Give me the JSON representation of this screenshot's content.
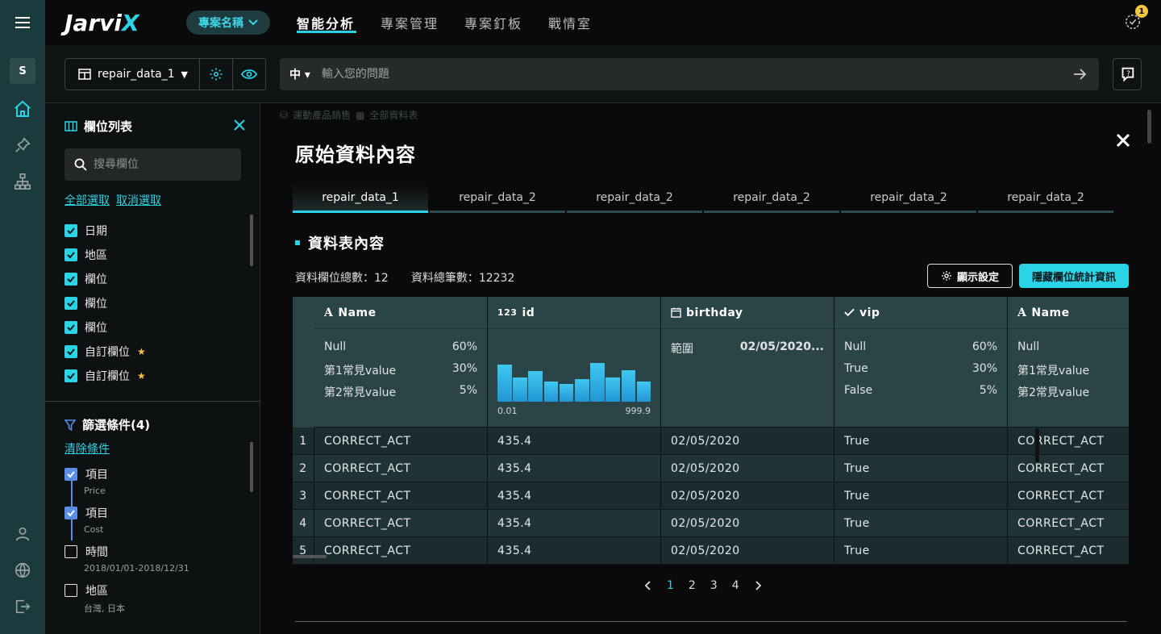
{
  "app": {
    "logo_text": "Jarvi",
    "logo_x": "X",
    "project_label": "專案名稱",
    "nav_tabs": [
      "智能分析",
      "專案管理",
      "專案釘板",
      "戰情室"
    ],
    "notification_count": "1",
    "user_initial": "S",
    "accent_color": "#2bd3e6"
  },
  "toolbar": {
    "dataset": "repair_data_1",
    "language": "中",
    "ask_placeholder": "輸入您的問題"
  },
  "sidebar": {
    "fields_title": "欄位列表",
    "search_placeholder": "搜尋欄位",
    "select_all": "全部選取",
    "deselect": "取消選取",
    "fields": [
      {
        "label": "日期",
        "custom": false
      },
      {
        "label": "地區",
        "custom": false
      },
      {
        "label": "欄位",
        "custom": false
      },
      {
        "label": "欄位",
        "custom": false
      },
      {
        "label": "欄位",
        "custom": false
      },
      {
        "label": "自訂欄位",
        "custom": true
      },
      {
        "label": "自訂欄位",
        "custom": true
      }
    ],
    "filter_title": "篩選條件(4)",
    "clear_filters": "清除條件",
    "filters": [
      {
        "label": "項目",
        "sub": "Price",
        "checked": true
      },
      {
        "label": "項目",
        "sub": "Cost",
        "checked": true
      },
      {
        "label": "時間",
        "sub": "2018/01/01-2018/12/31",
        "checked": false
      },
      {
        "label": "地區",
        "sub": "台灣, 日本",
        "checked": false
      }
    ]
  },
  "main": {
    "breadcrumb": [
      "運動產品銷售",
      "全部資料表"
    ],
    "title": "原始資料內容",
    "tabs": [
      "repair_data_1",
      "repair_data_2",
      "repair_data_2",
      "repair_data_2",
      "repair_data_2",
      "repair_data_2"
    ],
    "section_title": "資料表內容",
    "field_count": "資料欄位總數：12",
    "row_count": "資料總筆數：12232",
    "display_settings": "顯示設定",
    "hide_stats": "隱藏欄位統計資訊"
  },
  "table": {
    "columns": [
      {
        "icon": "A",
        "name": "Name"
      },
      {
        "icon": "123",
        "name": "id"
      },
      {
        "icon": "calendar",
        "name": "birthday"
      },
      {
        "icon": "check",
        "name": "vip"
      },
      {
        "icon": "A",
        "name": "Name"
      }
    ],
    "name_stats": [
      [
        "Null",
        "60%"
      ],
      [
        "第1常見value",
        "30%"
      ],
      [
        "第2常見value",
        "5%"
      ]
    ],
    "id_hist": {
      "min": "0.01",
      "max": "999.9",
      "bins": [
        0.95,
        0.62,
        0.8,
        0.52,
        0.45,
        0.58,
        1.0,
        0.62,
        0.82,
        0.52
      ]
    },
    "birthday_range": {
      "label": "範圍",
      "value": "02/05/2020..."
    },
    "vip_stats": [
      [
        "Null",
        "60%"
      ],
      [
        "True",
        "30%"
      ],
      [
        "False",
        "5%"
      ]
    ],
    "name2_stats": [
      "Null",
      "第1常見value",
      "第2常見value"
    ],
    "rows": [
      [
        "1",
        "CORRECT_ACT",
        "435.4",
        "02/05/2020",
        "True",
        "CORRECT_ACT"
      ],
      [
        "2",
        "CORRECT_ACT",
        "435.4",
        "02/05/2020",
        "True",
        "CORRECT_ACT"
      ],
      [
        "3",
        "CORRECT_ACT",
        "435.4",
        "02/05/2020",
        "True",
        "CORRECT_ACT"
      ],
      [
        "4",
        "CORRECT_ACT",
        "435.4",
        "02/05/2020",
        "True",
        "CORRECT_ACT"
      ],
      [
        "5",
        "CORRECT_ACT",
        "435.4",
        "02/05/2020",
        "True",
        "CORRECT_ACT"
      ]
    ]
  },
  "pager": {
    "pages": [
      "1",
      "2",
      "3",
      "4"
    ],
    "current": "1"
  }
}
